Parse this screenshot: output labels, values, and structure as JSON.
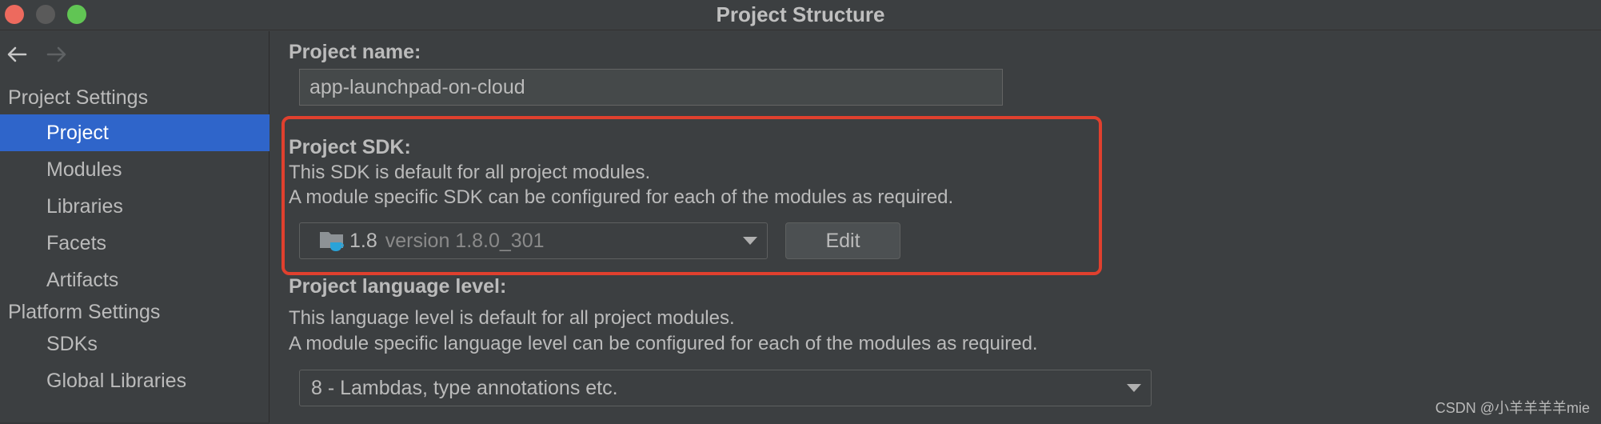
{
  "window": {
    "title": "Project Structure"
  },
  "sidebar": {
    "nav": {
      "back_icon": "arrow-left-icon",
      "forward_icon": "arrow-right-icon"
    },
    "project_settings_title": "Project Settings",
    "project_items": [
      {
        "label": "Project",
        "selected": true
      },
      {
        "label": "Modules",
        "selected": false
      },
      {
        "label": "Libraries",
        "selected": false
      },
      {
        "label": "Facets",
        "selected": false
      },
      {
        "label": "Artifacts",
        "selected": false
      }
    ],
    "platform_settings_title": "Platform Settings",
    "platform_items": [
      {
        "label": "SDKs"
      },
      {
        "label": "Global Libraries"
      }
    ]
  },
  "main": {
    "project_name_label": "Project name:",
    "project_name_value": "app-launchpad-on-cloud",
    "sdk": {
      "label": "Project SDK:",
      "desc_line1": "This SDK is default for all project modules.",
      "desc_line2": "A module specific SDK can be configured for each of the modules as required.",
      "selected_name": "1.8",
      "selected_version": "version 1.8.0_301",
      "icon": "sdk-folder-icon",
      "edit_label": "Edit"
    },
    "language_level": {
      "label": "Project language level:",
      "desc_line1": "This language level is default for all project modules.",
      "desc_line2": "A module specific language level can be configured for each of the modules as required.",
      "selected": "8 - Lambdas, type annotations etc."
    }
  },
  "watermark": "CSDN @小羊羊羊羊mie",
  "colors": {
    "background": "#3c3f41",
    "selection": "#2f65ca",
    "highlight_box": "#e0402e",
    "traffic_red": "#ed6a5e",
    "traffic_green": "#61c554"
  }
}
